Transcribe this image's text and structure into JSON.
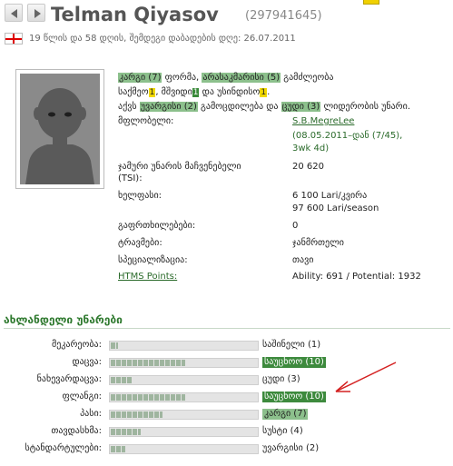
{
  "header": {
    "player_name": "Telman Qiyasov",
    "player_id": "(297941645)",
    "age_line": "19 წლის და 58 დღის, შემდეგი დაბადების დღე: 26.07.2011"
  },
  "description": {
    "line1": [
      {
        "t": "კარგი (7)",
        "s": "hl"
      },
      {
        "t": " ფორმა, ",
        "s": ""
      },
      {
        "t": "არასაკმარისი (5)",
        "s": "hl"
      },
      {
        "t": " გამძლეობა",
        "s": ""
      }
    ],
    "line2": [
      {
        "t": "საქმეო",
        "s": ""
      },
      {
        "t": "1",
        "s": "num"
      },
      {
        "t": ", მშვიდი",
        "s": ""
      },
      {
        "t": "1",
        "s": "num g"
      },
      {
        "t": " და უსინდისო",
        "s": ""
      },
      {
        "t": "1",
        "s": "num"
      },
      {
        "t": ".",
        "s": ""
      }
    ],
    "line3": [
      {
        "t": "აქვს ",
        "s": ""
      },
      {
        "t": "უვარგისი (2)",
        "s": "hl"
      },
      {
        "t": " გამოცდილება და ",
        "s": ""
      },
      {
        "t": "ცუდი (3)",
        "s": "hl"
      },
      {
        "t": " ლიდერობის უნარი.",
        "s": ""
      }
    ]
  },
  "info": {
    "owner_label": "მფლობელი:",
    "owner_link": "S.B.MegreLee",
    "owner_since": "(08.05.2011–დან (7/45),",
    "owner_weeks": "3wk 4d)",
    "tsi_label_1": "ჯამური უნარის მაჩვენებელი",
    "tsi_label_2": "(TSI):",
    "tsi_value": "20 620",
    "wage_label": "ხელფასი:",
    "wage_week": "6 100 Lari/კვირა",
    "wage_season": "97 600 Lari/season",
    "warnings_label": "გაფრთხილებები:",
    "warnings_value": "0",
    "injury_label": "ტრავმები:",
    "injury_value": "ჯანმრთელი",
    "specialty_label": "სპეციალიზაცია:",
    "specialty_value": "თავი",
    "htms_label": "HTMS Points:",
    "htms_value": "Ability: 691 / Potential: 1932"
  },
  "skills_title": "ახლანდელი უნარები",
  "skills": [
    {
      "label": "მეკარეობა:",
      "level_text": "საშინელი (1)",
      "level": 1,
      "max": 20,
      "style": "plain"
    },
    {
      "label": "დაცვა:",
      "level_text": "საუცხოო (10)",
      "level": 10,
      "max": 20,
      "style": "dark"
    },
    {
      "label": "ნახევარდაცვა:",
      "level_text": "ცუდი (3)",
      "level": 3,
      "max": 20,
      "style": "plain"
    },
    {
      "label": "ფლანგი:",
      "level_text": "საუცხოო (10)",
      "level": 10,
      "max": 20,
      "style": "dark"
    },
    {
      "label": "პასი:",
      "level_text": "კარგი (7)",
      "level": 7,
      "max": 20,
      "style": "light"
    },
    {
      "label": "თავდასხმა:",
      "level_text": "სუსტი (4)",
      "level": 4,
      "max": 20,
      "style": "plain"
    },
    {
      "label": "სტანდარტულები:",
      "level_text": "უვარგისი (2)",
      "level": 2,
      "max": 20,
      "style": "plain"
    }
  ],
  "colors": {
    "accent_green": "#2f7a2f",
    "highlight_green": "#8cc08c",
    "arrow_red": "#d42020"
  }
}
